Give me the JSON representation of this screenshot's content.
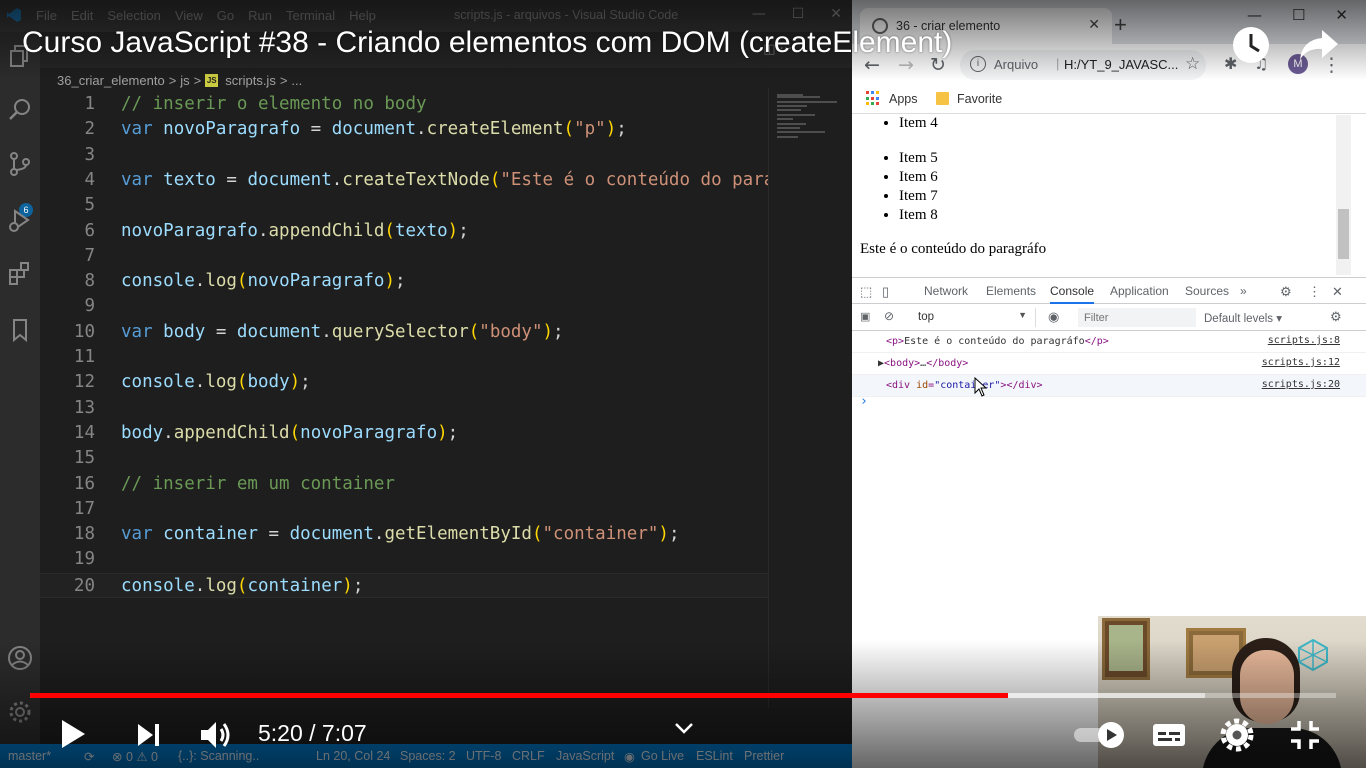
{
  "vscode": {
    "menu": [
      "File",
      "Edit",
      "Selection",
      "View",
      "Go",
      "Run",
      "Terminal",
      "Help"
    ],
    "window_title": "scripts.js - arquivos - Visual Studio Code",
    "breadcrumb": [
      "36_criar_elemento",
      ">",
      "js",
      ">",
      "scripts.js",
      ">",
      "..."
    ],
    "activity_badge": "6",
    "editor": {
      "lines": [
        {
          "n": "1",
          "tokens": [
            {
              "c": "cm",
              "t": "// inserir o elemento no body"
            }
          ]
        },
        {
          "n": "2",
          "tokens": [
            {
              "c": "kw",
              "t": "var "
            },
            {
              "c": "var",
              "t": "novoParagrafo"
            },
            {
              "c": "pl",
              "t": " = "
            },
            {
              "c": "var",
              "t": "document"
            },
            {
              "c": "pl",
              "t": "."
            },
            {
              "c": "fn",
              "t": "createElement"
            },
            {
              "c": "p1",
              "t": "("
            },
            {
              "c": "str",
              "t": "\"p\""
            },
            {
              "c": "p1",
              "t": ")"
            },
            {
              "c": "pl",
              "t": ";"
            }
          ]
        },
        {
          "n": "3",
          "tokens": []
        },
        {
          "n": "4",
          "tokens": [
            {
              "c": "kw",
              "t": "var "
            },
            {
              "c": "var",
              "t": "texto"
            },
            {
              "c": "pl",
              "t": " = "
            },
            {
              "c": "var",
              "t": "document"
            },
            {
              "c": "pl",
              "t": "."
            },
            {
              "c": "fn",
              "t": "createTextNode"
            },
            {
              "c": "p1",
              "t": "("
            },
            {
              "c": "str",
              "t": "\"Este é o conteúdo do parágrafo\""
            }
          ]
        },
        {
          "n": "5",
          "tokens": []
        },
        {
          "n": "6",
          "tokens": [
            {
              "c": "var",
              "t": "novoParagrafo"
            },
            {
              "c": "pl",
              "t": "."
            },
            {
              "c": "fn",
              "t": "appendChild"
            },
            {
              "c": "p1",
              "t": "("
            },
            {
              "c": "var",
              "t": "texto"
            },
            {
              "c": "p1",
              "t": ")"
            },
            {
              "c": "pl",
              "t": ";"
            }
          ]
        },
        {
          "n": "7",
          "tokens": []
        },
        {
          "n": "8",
          "tokens": [
            {
              "c": "var",
              "t": "console"
            },
            {
              "c": "pl",
              "t": "."
            },
            {
              "c": "fn",
              "t": "log"
            },
            {
              "c": "p1",
              "t": "("
            },
            {
              "c": "var",
              "t": "novoParagrafo"
            },
            {
              "c": "p1",
              "t": ")"
            },
            {
              "c": "pl",
              "t": ";"
            }
          ]
        },
        {
          "n": "9",
          "tokens": []
        },
        {
          "n": "10",
          "tokens": [
            {
              "c": "kw",
              "t": "var "
            },
            {
              "c": "var",
              "t": "body"
            },
            {
              "c": "pl",
              "t": " = "
            },
            {
              "c": "var",
              "t": "document"
            },
            {
              "c": "pl",
              "t": "."
            },
            {
              "c": "fn",
              "t": "querySelector"
            },
            {
              "c": "p1",
              "t": "("
            },
            {
              "c": "str",
              "t": "\"body\""
            },
            {
              "c": "p1",
              "t": ")"
            },
            {
              "c": "pl",
              "t": ";"
            }
          ]
        },
        {
          "n": "11",
          "tokens": []
        },
        {
          "n": "12",
          "tokens": [
            {
              "c": "var",
              "t": "console"
            },
            {
              "c": "pl",
              "t": "."
            },
            {
              "c": "fn",
              "t": "log"
            },
            {
              "c": "p1",
              "t": "("
            },
            {
              "c": "var",
              "t": "body"
            },
            {
              "c": "p1",
              "t": ")"
            },
            {
              "c": "pl",
              "t": ";"
            }
          ]
        },
        {
          "n": "13",
          "tokens": []
        },
        {
          "n": "14",
          "tokens": [
            {
              "c": "var",
              "t": "body"
            },
            {
              "c": "pl",
              "t": "."
            },
            {
              "c": "fn",
              "t": "appendChild"
            },
            {
              "c": "p1",
              "t": "("
            },
            {
              "c": "var",
              "t": "novoParagrafo"
            },
            {
              "c": "p1",
              "t": ")"
            },
            {
              "c": "pl",
              "t": ";"
            }
          ]
        },
        {
          "n": "15",
          "tokens": []
        },
        {
          "n": "16",
          "tokens": [
            {
              "c": "cm",
              "t": "// inserir em um container"
            }
          ]
        },
        {
          "n": "17",
          "tokens": []
        },
        {
          "n": "18",
          "tokens": [
            {
              "c": "kw",
              "t": "var "
            },
            {
              "c": "var",
              "t": "container"
            },
            {
              "c": "pl",
              "t": " = "
            },
            {
              "c": "var",
              "t": "document"
            },
            {
              "c": "pl",
              "t": "."
            },
            {
              "c": "fn",
              "t": "getElementById"
            },
            {
              "c": "p1",
              "t": "("
            },
            {
              "c": "str",
              "t": "\"container\""
            },
            {
              "c": "p1",
              "t": ")"
            },
            {
              "c": "pl",
              "t": ";"
            }
          ]
        },
        {
          "n": "19",
          "tokens": []
        },
        {
          "n": "20",
          "tokens": [
            {
              "c": "var",
              "t": "console"
            },
            {
              "c": "pl",
              "t": "."
            },
            {
              "c": "fn",
              "t": "log"
            },
            {
              "c": "p1",
              "t": "("
            },
            {
              "c": "var",
              "t": "container"
            },
            {
              "c": "p1",
              "t": ")"
            },
            {
              "c": "pl",
              "t": ";"
            }
          ]
        }
      ],
      "current_line": "20"
    },
    "statusbar": {
      "branch": "master*",
      "sync": "⟳",
      "problems": "⊗ 0 ⚠ 0",
      "scanning": "{..}: Scanning..",
      "position": "Ln 20, Col 24",
      "spaces": "Spaces: 2",
      "encoding": "UTF-8",
      "eol": "CRLF",
      "language": "JavaScript",
      "golive": "Go Live",
      "eslint": "ESLint",
      "prettier": "Prettier"
    }
  },
  "chrome": {
    "tab_title": "36 - criar elemento",
    "address_label": "Arquivo",
    "address_url": "H:/YT_9_JAVASC...",
    "profile_initial": "M",
    "bookmarks": [
      "Apps",
      "Favorite"
    ],
    "page": {
      "items_top": [
        "Item 4"
      ],
      "items_bottom": [
        "Item 5",
        "Item 6",
        "Item 7",
        "Item 8"
      ],
      "paragraph": "Este é o conteúdo do paragráfo"
    },
    "devtools": {
      "tabs": [
        "Network",
        "Elements",
        "Console",
        "Application",
        "Sources",
        "»"
      ],
      "active_tab": "Console",
      "context": "top",
      "filter_placeholder": "Filter",
      "levels": "Default levels ▾",
      "console": [
        {
          "html": "<span class=\"tag\">&lt;p&gt;</span><span class=\"txt\">Este é o conteúdo do paragráfo</span><span class=\"tag\">&lt;/p&gt;</span>",
          "src": "scripts.js:8"
        },
        {
          "html": "<span class=\"txt\">▶</span><span class=\"tag\">&lt;body&gt;</span><span class=\"txt\">…</span><span class=\"tag\">&lt;/body&gt;</span>",
          "src": "scripts.js:12"
        },
        {
          "html": "<span class=\"tag\">&lt;div </span><span class=\"attr\">id</span><span class=\"tag\">=</span><span class=\"aval\">\"container\"</span><span class=\"tag\">&gt;&lt;/div&gt;</span>",
          "src": "scripts.js:20"
        }
      ],
      "prompt": "›"
    }
  },
  "youtube": {
    "title": "Curso JavaScript #38 - Criando elementos com DOM (createElement)",
    "time": "5:20 / 7:07",
    "progress_played": 0.749,
    "progress_loaded": 0.9
  }
}
